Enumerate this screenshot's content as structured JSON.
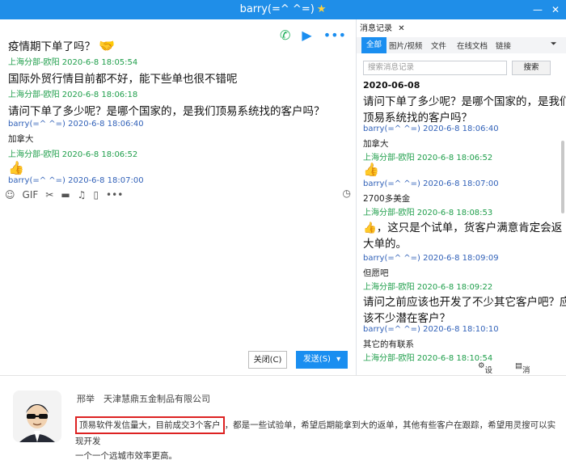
{
  "window": {
    "title": "barry(=^ ^=)"
  },
  "chat": {
    "messages": [
      {
        "kind": "text",
        "size": "big",
        "text": "疫情期下单了吗？",
        "emoji": "🤝"
      },
      {
        "kind": "sender",
        "who": "them",
        "text": "上海分部-欧阳 2020-6-8 18:05:54"
      },
      {
        "kind": "text",
        "size": "big",
        "text": "国际外贸行情目前都不好，能下些单也很不错呢"
      },
      {
        "kind": "sender",
        "who": "them",
        "text": "上海分部-欧阳 2020-6-8 18:06:18"
      },
      {
        "kind": "text",
        "size": "big",
        "text": "请问下单了多少呢？是哪个国家的，是我们顶易系统找的客户吗？"
      },
      {
        "kind": "sender",
        "who": "me",
        "text": "barry(=^ ^=) 2020-6-8 18:06:40"
      },
      {
        "kind": "text",
        "size": "small",
        "text": "加拿大"
      },
      {
        "kind": "sender",
        "who": "them",
        "text": "上海分部-欧阳 2020-6-8 18:06:52"
      },
      {
        "kind": "emoji",
        "text": "👍"
      },
      {
        "kind": "sender",
        "who": "me",
        "text": "barry(=^ ^=) 2020-6-8 18:07:00"
      }
    ],
    "close_label": "关闭(C)",
    "send_label": "发送(S)"
  },
  "history": {
    "tab_title": "消息记录",
    "filters": [
      "全部",
      "图片/视频",
      "文件",
      "在线文档",
      "链接"
    ],
    "search_placeholder": "搜索消息记录",
    "search_button": "搜索",
    "date": "2020-06-08",
    "items": [
      {
        "kind": "text",
        "size": "big",
        "text": "请问下单了多少呢？是哪个国家的，是我们"
      },
      {
        "kind": "text",
        "size": "big",
        "text": "顶易系统找的客户吗？"
      },
      {
        "kind": "sender",
        "who": "me",
        "text": "barry(=^ ^=) 2020-6-8 18:06:40"
      },
      {
        "kind": "text",
        "size": "small",
        "text": "加拿大"
      },
      {
        "kind": "sender",
        "who": "them",
        "text": "上海分部-欧阳 2020-6-8 18:06:52"
      },
      {
        "kind": "emoji",
        "text": "👍"
      },
      {
        "kind": "sender",
        "who": "me",
        "text": "barry(=^ ^=) 2020-6-8 18:07:00"
      },
      {
        "kind": "text",
        "size": "small",
        "text": "2700多美金"
      },
      {
        "kind": "sender",
        "who": "them",
        "text": "上海分部-欧阳 2020-6-8 18:08:53"
      },
      {
        "kind": "text",
        "size": "big",
        "text": "👍，这只是个试单，货客户满意肯定会返"
      },
      {
        "kind": "text",
        "size": "big",
        "text": "大单的。"
      },
      {
        "kind": "sender",
        "who": "me",
        "text": "barry(=^ ^=) 2020-6-8 18:09:09"
      },
      {
        "kind": "text",
        "size": "small",
        "text": "但愿吧"
      },
      {
        "kind": "sender",
        "who": "them",
        "text": "上海分部-欧阳 2020-6-8 18:09:22"
      },
      {
        "kind": "text",
        "size": "big",
        "text": "请问之前应该也开发了不少其它客户吧？应"
      },
      {
        "kind": "text",
        "size": "big",
        "text": "该不少潜在客户？"
      },
      {
        "kind": "sender",
        "who": "me",
        "text": "barry(=^ ^=) 2020-6-8 18:10:10"
      },
      {
        "kind": "text",
        "size": "small",
        "text": "其它的有联系"
      },
      {
        "kind": "sender",
        "who": "them",
        "text": "上海分部-欧阳 2020-6-8 18:10:54"
      }
    ],
    "settings_label": "设置",
    "manage_label": "消息管理"
  },
  "article": {
    "author": "邢举",
    "company": "天津慧鼎五金制品有限公司",
    "highlight": "顶易软件发信量大，目前成交3个客户",
    "rest_line1": "，都是一些试验单，希望后期能拿到大的返单，其他有些客户在跟踪，希望用灵搜可以实现开发",
    "rest_line2": "一个一个远城市效率更高。"
  },
  "colors": {
    "accent": "#1a8ef0",
    "sender_them": "#1e9e4a",
    "sender_me": "#3161b8",
    "highlight_border": "#dd2222"
  }
}
